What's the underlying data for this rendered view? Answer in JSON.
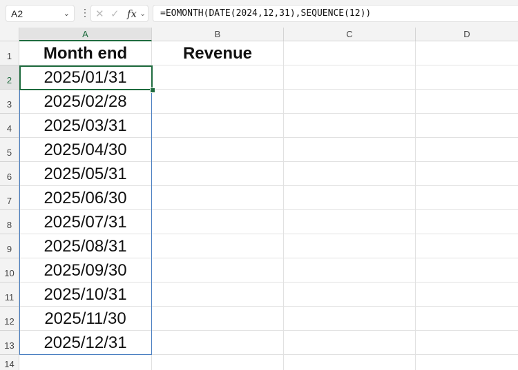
{
  "name_box": "A2",
  "formula": "=EOMONTH(DATE(2024,12,31),SEQUENCE(12))",
  "fx_label": "fx",
  "columns": [
    "A",
    "B",
    "C",
    "D"
  ],
  "rows": [
    "1",
    "2",
    "3",
    "4",
    "5",
    "6",
    "7",
    "8",
    "9",
    "10",
    "11",
    "12",
    "13",
    "14"
  ],
  "headers": {
    "a1": "Month end",
    "b1": "Revenue"
  },
  "dates": [
    "2025/01/31",
    "2025/02/28",
    "2025/03/31",
    "2025/04/30",
    "2025/05/31",
    "2025/06/30",
    "2025/07/31",
    "2025/08/31",
    "2025/09/30",
    "2025/10/31",
    "2025/11/30",
    "2025/12/31"
  ]
}
